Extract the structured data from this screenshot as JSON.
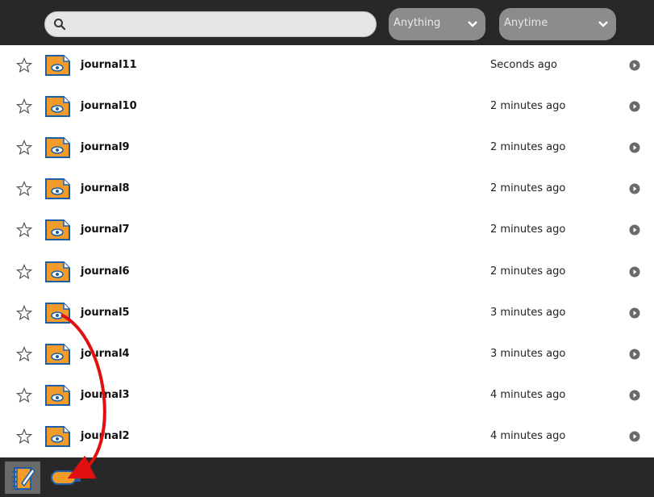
{
  "search": {
    "placeholder": "",
    "value": "",
    "icon": "search-icon"
  },
  "filters": {
    "what": {
      "label": "Anything",
      "icon": "chevron-down-icon"
    },
    "when": {
      "label": "Anytime",
      "icon": "chevron-down-icon"
    }
  },
  "colors": {
    "toolbar": "#282828",
    "icon_fill": "#f29b2a",
    "icon_stroke": "#1c5fa8",
    "arrow": "#e01010"
  },
  "entries": [
    {
      "title": "journal11",
      "time": "Seconds ago"
    },
    {
      "title": "journal10",
      "time": "2 minutes ago"
    },
    {
      "title": "journal9",
      "time": "2 minutes ago"
    },
    {
      "title": "journal8",
      "time": "2 minutes ago"
    },
    {
      "title": "journal7",
      "time": "2 minutes ago"
    },
    {
      "title": "journal6",
      "time": "2 minutes ago"
    },
    {
      "title": "journal5",
      "time": "3 minutes ago"
    },
    {
      "title": "journal4",
      "time": "3 minutes ago"
    },
    {
      "title": "journal3",
      "time": "4 minutes ago"
    },
    {
      "title": "journal2",
      "time": "4 minutes ago"
    }
  ],
  "footer": {
    "devices": [
      {
        "name": "journal",
        "icon": "journal-icon",
        "selected": true
      },
      {
        "name": "usb-drive",
        "icon": "usb-drive-icon",
        "selected": false
      }
    ]
  }
}
